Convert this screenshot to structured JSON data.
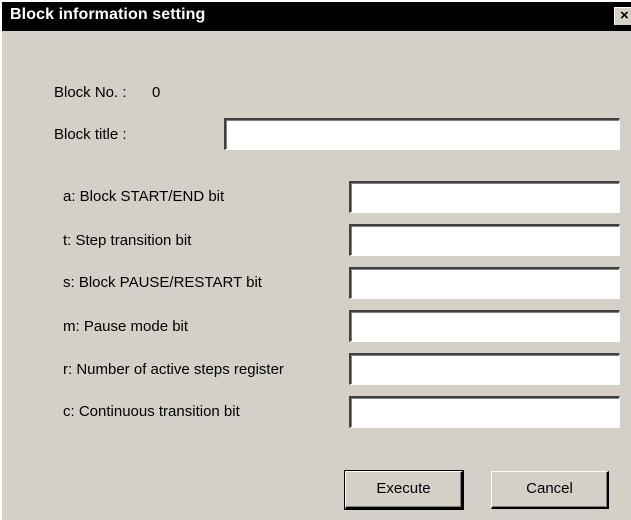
{
  "window": {
    "title": "Block information setting",
    "close_glyph": "×"
  },
  "block_no": {
    "label": "Block No. :",
    "value": "0"
  },
  "block_title": {
    "label": "Block title :",
    "value": ""
  },
  "fields": [
    {
      "label": "a: Block START/END bit",
      "value": ""
    },
    {
      "label": "t: Step transition bit",
      "value": ""
    },
    {
      "label": "s: Block PAUSE/RESTART bit",
      "value": ""
    },
    {
      "label": "m: Pause mode bit",
      "value": ""
    },
    {
      "label": "r: Number of active steps register",
      "value": ""
    },
    {
      "label": "c: Continuous transition bit",
      "value": ""
    }
  ],
  "buttons": {
    "execute_label": "Execute",
    "cancel_label": "Cancel"
  },
  "colors": {
    "titlebar": "#000000",
    "dialog_face": "#d4d0c8",
    "field_bg": "#ffffff"
  }
}
